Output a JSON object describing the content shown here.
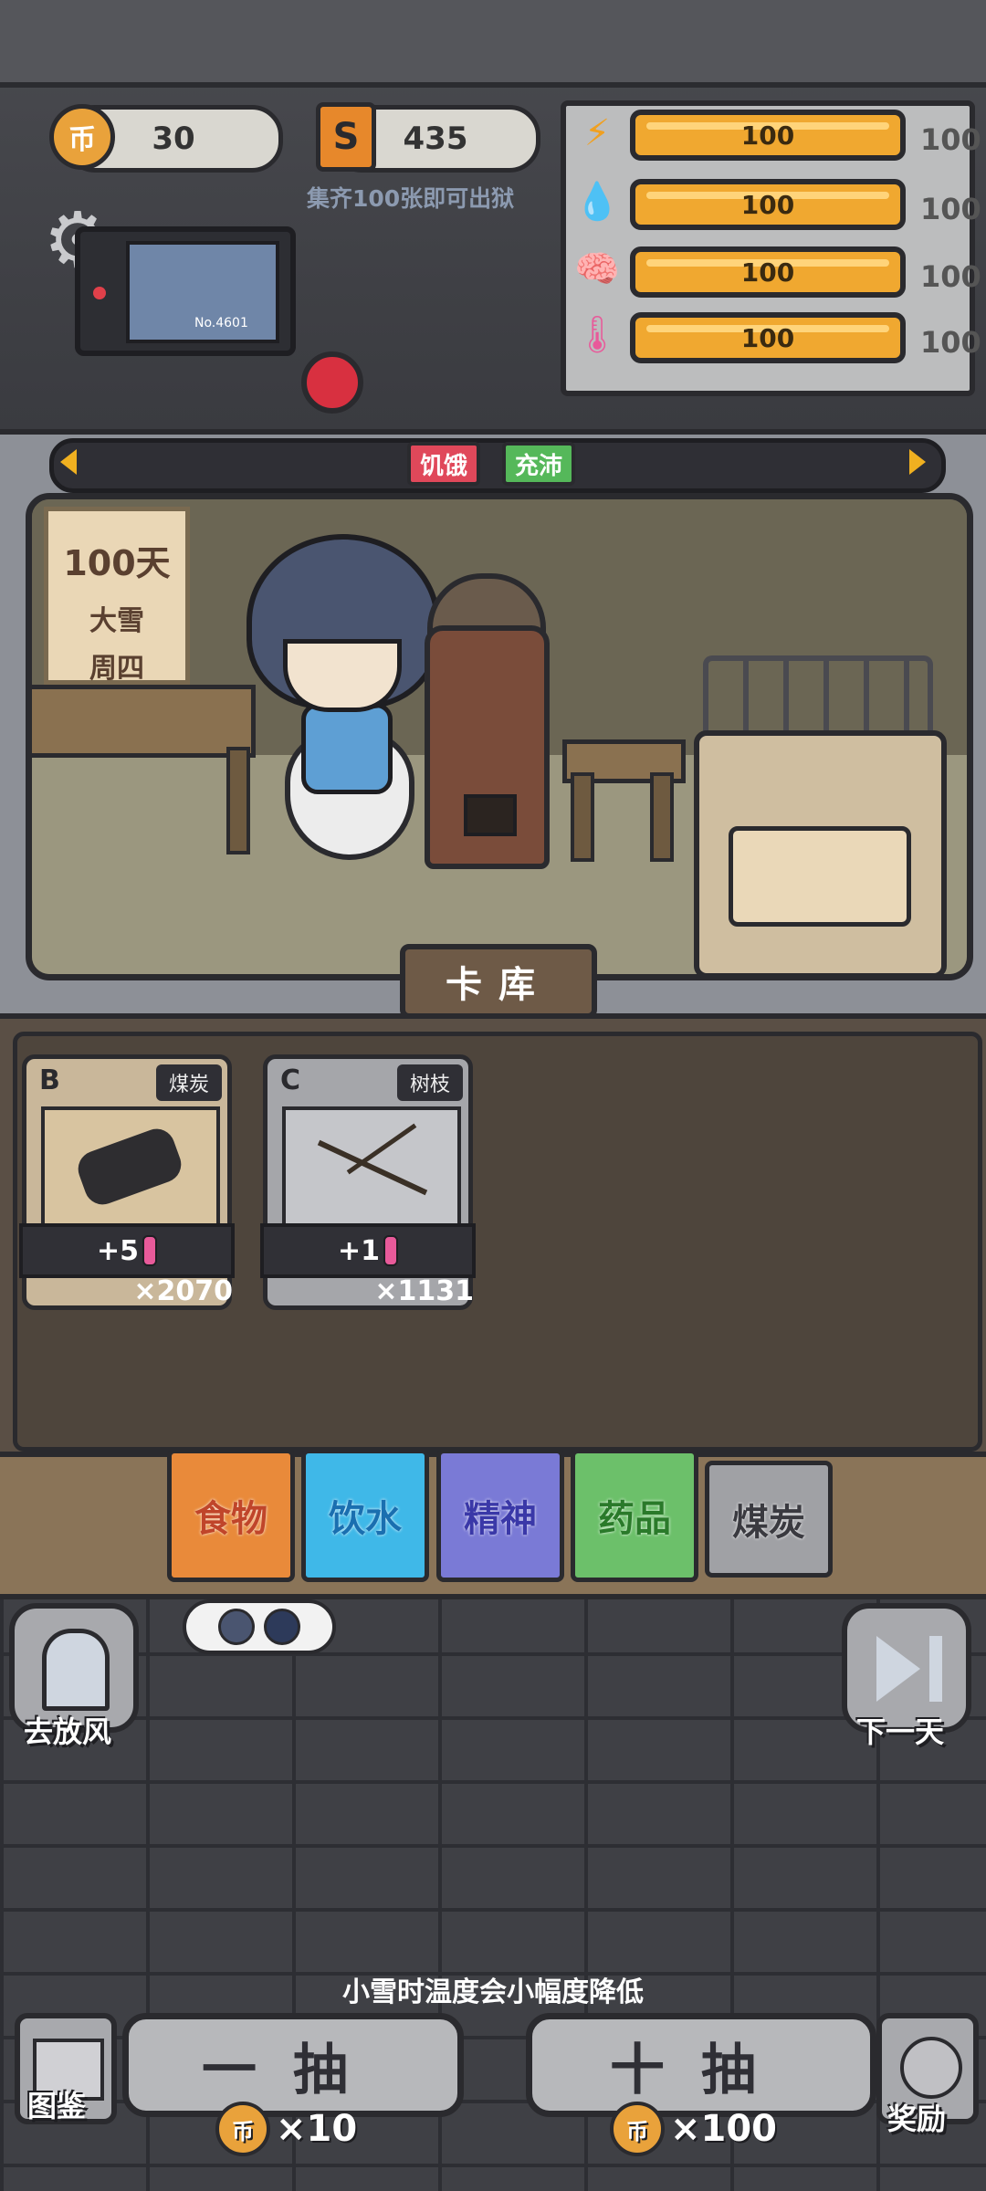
{
  "resources": {
    "coins": "30",
    "coin_symbol": "币",
    "s_symbol": "S",
    "s_value": "435",
    "hint": "集齐100张即可出狱"
  },
  "monitor": {
    "number": "No.4601"
  },
  "stats": [
    {
      "icon": "energy-icon",
      "glyph": "⚡",
      "color": "#f0a020",
      "value": "100",
      "max": "100"
    },
    {
      "icon": "water-icon",
      "glyph": "💧",
      "color": "#4aa0e8",
      "value": "100",
      "max": "100"
    },
    {
      "icon": "brain-icon",
      "glyph": "🧠",
      "color": "#7e86e0",
      "value": "100",
      "max": "100"
    },
    {
      "icon": "thermometer-icon",
      "glyph": "🌡",
      "color": "#e85a9a",
      "value": "100",
      "max": "100"
    }
  ],
  "status_tags": [
    {
      "label": "饥饿",
      "color": "#e0485a"
    },
    {
      "label": "充沛",
      "color": "#55b85a"
    }
  ],
  "day_sign": {
    "day": "100天",
    "weather": "大雪",
    "weekday": "周四"
  },
  "storage_title": "卡库",
  "cards": [
    {
      "grade": "B",
      "title": "煤炭",
      "bonus": "+5",
      "count": "×2070",
      "bg": "#c9b79a"
    },
    {
      "grade": "C",
      "title": "树枝",
      "bonus": "+1",
      "count": "×1131",
      "bg": "#a5a6aa"
    }
  ],
  "categories": [
    {
      "label": "食物",
      "bg": "#e98a3a",
      "fg": "#c0452a"
    },
    {
      "label": "饮水",
      "bg": "#3fb8e8",
      "fg": "#1a7ec0"
    },
    {
      "label": "精神",
      "bg": "#7a7ad6",
      "fg": "#4a48b8"
    },
    {
      "label": "药品",
      "bg": "#6cc06a",
      "fg": "#3a8a3a"
    },
    {
      "label": "煤炭",
      "bg": "#a0a1a5",
      "fg": "#3a3a40"
    }
  ],
  "left_action": "去放风",
  "right_action": "下一天",
  "tip": "小雪时温度会小幅度降低",
  "draw_one": {
    "label": "一抽",
    "cost": "×10"
  },
  "draw_ten": {
    "label": "十抽",
    "cost": "×100"
  },
  "guide": "图鉴",
  "reward": "奖励"
}
